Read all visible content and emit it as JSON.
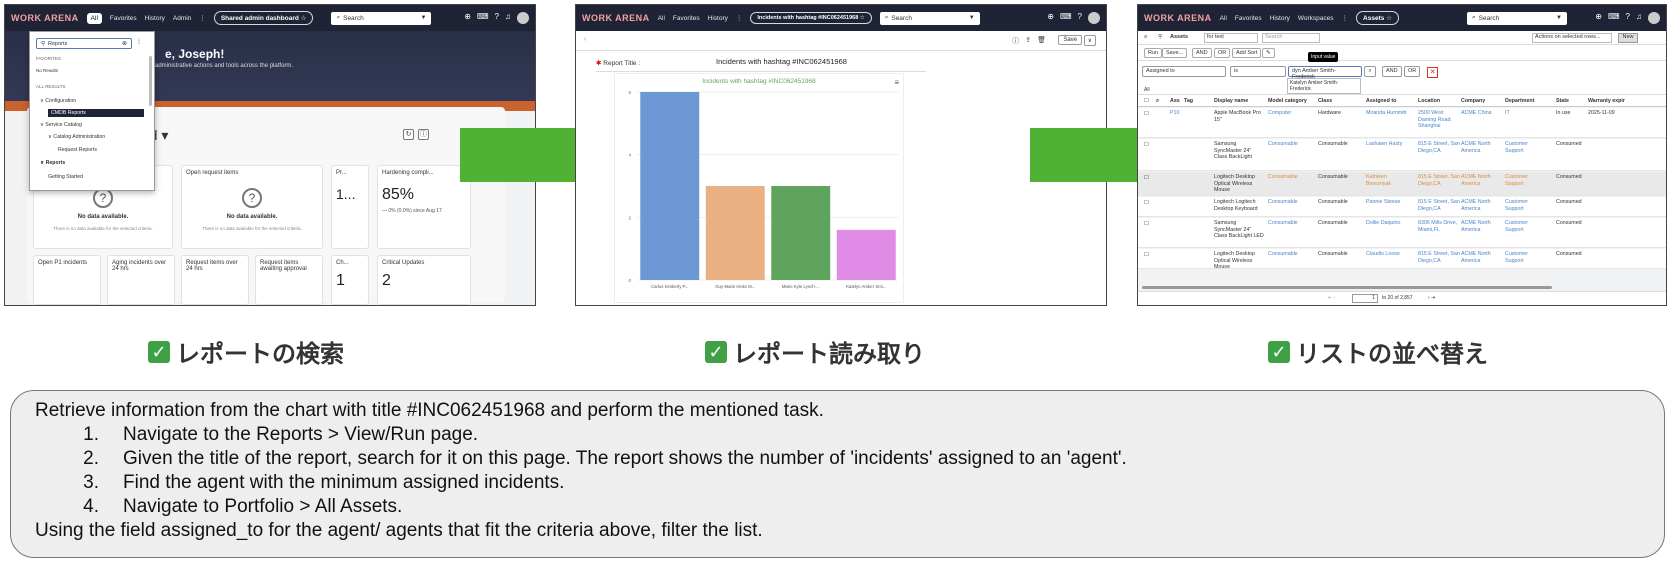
{
  "screen1": {
    "logo": "WORK ARENA",
    "nav": [
      "All",
      "Favorites",
      "History",
      "Admin"
    ],
    "nav_more": "⋮",
    "pill": "Shared admin dashboard ☆",
    "search_placeholder": "Search",
    "hero_title": "e, Joseph!",
    "hero_sub": "administrative actions and tools across the platform.",
    "dashboard_name": "rd ▾",
    "filter_value": "Reports",
    "favorites_label": "FAVORITES",
    "no_results": "No Results",
    "all_results_label": "ALL RESULTS",
    "tree": [
      "Configuration",
      "CMDB Reports",
      "Service Catalog",
      "Catalog Administration",
      "Request Reports",
      "Reports",
      "Getting Started"
    ],
    "cards": [
      {
        "title": "",
        "no_data": "No data available.",
        "no_data_sub": "There is no data available for the selected criteria."
      },
      {
        "title": "Open request items",
        "no_data": "No data available.",
        "no_data_sub": "There is no data available for the selected criteria."
      },
      {
        "title": "Pr...",
        "value": "1..."
      },
      {
        "title": "Hardening compli...",
        "value": "85%",
        "trend": "— 0% (0.0%) since Aug 17"
      },
      {
        "title": "Open P1 incidents"
      },
      {
        "title": "Aging incidents over 24 hrs"
      },
      {
        "title": "Request items over 24 hrs"
      },
      {
        "title": "Request items awaiting approval"
      },
      {
        "title": "Ch...",
        "value": "1"
      },
      {
        "title": "Critical Updates",
        "value": "2"
      }
    ]
  },
  "screen2": {
    "logo": "WORK ARENA",
    "nav": [
      "All",
      "Favorites",
      "History"
    ],
    "nav_more": "⋮",
    "pill": "Incidents with hashtag #INC062451968 ☆",
    "search_placeholder": "Search",
    "save_label": "Save",
    "report_title_label": "Report Title :",
    "report_title_value": "Incidents with hashtag #INC062451968"
  },
  "chart_data": {
    "type": "bar",
    "title": "Incidents with hashtag #INC062451968",
    "categories": [
      "Carlos Kimberly P...",
      "Guy-Marie Hicks M...",
      "Marie Kyle Lynch-...",
      "Katelyn Amber Smi..."
    ],
    "values": [
      6,
      3,
      3,
      1.6
    ],
    "ylim": [
      0,
      6
    ],
    "yticks": [
      "0",
      "2",
      "4",
      "6"
    ],
    "colors": [
      "#6b98d4",
      "#e9b083",
      "#5fa45c",
      "#e08be6"
    ],
    "grid": true,
    "legend": "none"
  },
  "screen3": {
    "logo": "WORK ARENA",
    "nav": [
      "All",
      "Favorites",
      "History",
      "Workspaces"
    ],
    "nav_more": "⋮",
    "pill": "Assets ☆",
    "search_placeholder": "Search",
    "list_title": "Assets",
    "for_text": "for text",
    "search_text": "Search",
    "actions": "Actions on selected rows...",
    "new_label": "New",
    "run": "Run",
    "save": "Save...",
    "and": "AND",
    "or": "OR",
    "add_sort": "Add Sort",
    "field": "Assigned to",
    "operator": "is",
    "value": "dyn Amber Smith-Frederick",
    "tooltip": "Input value",
    "suggestion": "Katelyn Amber Smith-Frederick",
    "all": "All",
    "columns": [
      "Ass",
      "Tag",
      "Display name",
      "Model category",
      "Class",
      "Assigned to",
      "Location",
      "Company",
      "Department",
      "State",
      "Warranty expir"
    ],
    "rows": [
      {
        "ass": "P10",
        "name": "Apple MacBook Pro 15\"",
        "model": "Computer",
        "class": "Hardware",
        "assigned": "Miranda Hummitt",
        "location": "2500 West Daming Road, Shanghai",
        "company": "ACME China",
        "dept": "IT",
        "state": "In use",
        "warranty": "2025-11-09"
      },
      {
        "ass": "",
        "name": "Samsung SyncMaster 24\" Class BackLight",
        "model": "Consumable",
        "class": "Consumable",
        "assigned": "Lashawn Hasty",
        "location": "815 E Street, San Diego,CA",
        "company": "ACME North America",
        "dept": "Customer Support",
        "state": "Consumed",
        "warranty": ""
      },
      {
        "ass": "",
        "name": "Logitech Desktop Optical Wireless Mouse",
        "model": "Consumable",
        "class": "Consumable",
        "assigned": "Kathleen Bereznyak",
        "location": "815 E Street, San Diego,CA",
        "company": "ACME North America",
        "dept": "Customer Support",
        "state": "Consumed",
        "warranty": ""
      },
      {
        "ass": "",
        "name": "Logitech Logitech Desktop Keyboard",
        "model": "Consumable",
        "class": "Consumable",
        "assigned": "Pannie Steese",
        "location": "815 E Street, San Diego,CA",
        "company": "ACME North America",
        "dept": "Customer Support",
        "state": "Consumed",
        "warranty": ""
      },
      {
        "ass": "",
        "name": "Samsung SyncMaster 24\" Class BackLight LED",
        "model": "Consumable",
        "class": "Consumable",
        "assigned": "Dollie Daquino",
        "location": "8306 Mills Drive, Miami,FL",
        "company": "ACME North America",
        "dept": "Customer Support",
        "state": "Consumed",
        "warranty": ""
      },
      {
        "ass": "",
        "name": "Logitech Desktop Optical Wireless Mouse",
        "model": "Consumable",
        "class": "Consumable",
        "assigned": "Claudio Loose",
        "location": "815 E Street, San Diego,CA",
        "company": "ACME North America",
        "dept": "Customer Support",
        "state": "Consumed",
        "warranty": ""
      }
    ],
    "pager_page": "1",
    "pager_text": "to 20 of 2,857"
  },
  "captions": [
    "レポートの検索",
    "レポート読み取り",
    "リストの並べ替え"
  ],
  "instructions": {
    "intro": "Retrieve information from the chart with title #INC062451968 and perform the mentioned task.",
    "steps": [
      {
        "num": "1.",
        "text": "Navigate to the Reports > View/Run page."
      },
      {
        "num": "2.",
        "text": "Given the title of the report, search for it on this page. The report shows the number of 'incidents' assigned to an 'agent'."
      },
      {
        "num": "3.",
        "text": "Find the agent with the minimum assigned incidents."
      },
      {
        "num": "4.",
        "text": "Navigate to Portfolio > All Assets."
      }
    ],
    "outro": "Using the field assigned_to for the agent/ agents that fit the criteria above, filter the list."
  },
  "colors": {
    "arrow": "#4fb234",
    "check": "#3fa046",
    "nav_bg": "#1e2436",
    "chart_title": "#62a55b"
  }
}
